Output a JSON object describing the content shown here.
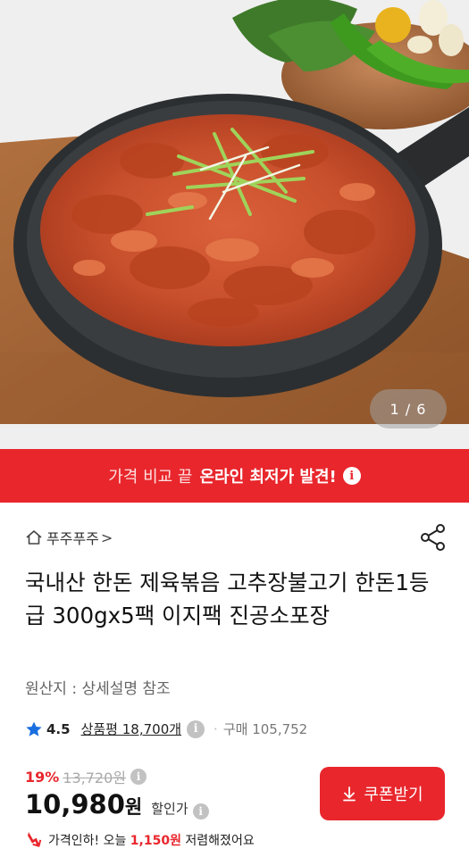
{
  "gallery": {
    "counter": "1 / 6",
    "image_alt": "제육볶음 in cast-iron skillet with green onions on wooden board"
  },
  "banner": {
    "prefix": "가격 비교 끝",
    "highlight": "온라인 최저가 발견!",
    "info_icon": "info-icon"
  },
  "store": {
    "name": "푸주푸주",
    "chevron": ">",
    "home_icon": "home-icon"
  },
  "share_icon": "share-icon",
  "product": {
    "title": "국내산 한돈 제육볶음 고추장불고기 한돈1등급 300gx5팩 이지팩 진공소포장",
    "origin": "원산지 : 상세설명 참조"
  },
  "rating": {
    "score": "4.5",
    "reviews": "상품평 18,700개",
    "separator": "·",
    "sales": "구매 105,752",
    "star_color": "#1a6fe0"
  },
  "price": {
    "discount_pct": "19%",
    "original": "13,720원",
    "current": "10,980",
    "currency": "원",
    "applied_label": "할인가",
    "info_label": "i"
  },
  "coupon": {
    "label": "쿠폰받기",
    "icon": "download-arrow-icon"
  },
  "price_drop": {
    "prefix": "가격인하! 오늘 ",
    "amount": "1,150원",
    "suffix": " 저렴해졌어요",
    "icon": "price-down-arrow-icon"
  },
  "colors": {
    "accent": "#e8262c",
    "star": "#1a6fe0"
  }
}
